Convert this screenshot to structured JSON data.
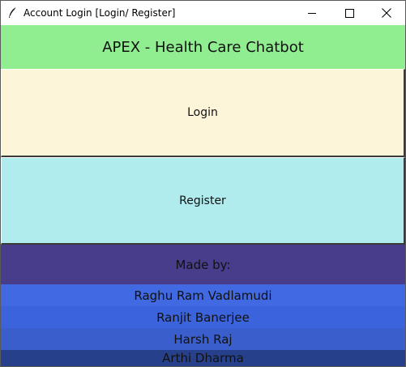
{
  "window": {
    "title": "Account Login [Login/ Register]",
    "icon": "feather-icon"
  },
  "controls": {
    "minimize": "minimize-icon",
    "maximize": "maximize-icon",
    "close": "close-icon"
  },
  "header": {
    "title": "APEX - Health Care Chatbot"
  },
  "buttons": {
    "login_label": "Login",
    "register_label": "Register"
  },
  "credits": {
    "label": "Made by:",
    "names": [
      "Raghu Ram Vadlamudi",
      "Ranjit Banerjee",
      "Harsh Raj",
      "Arthi Dharma"
    ]
  },
  "colors": {
    "header_bg": "#90ee90",
    "login_bg": "#fdf5da",
    "register_bg": "#b0ebed",
    "madeby_bg": "#483d8b",
    "name_bgs": [
      "#4169e1",
      "#3b63dc",
      "#3a5fcd",
      "#27408b"
    ]
  }
}
